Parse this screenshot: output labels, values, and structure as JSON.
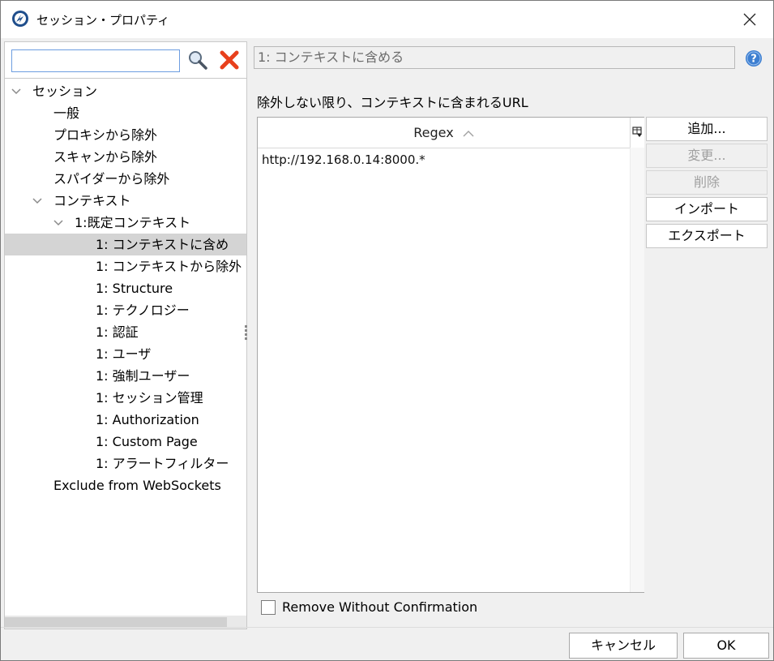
{
  "window": {
    "title": "セッション・プロパティ"
  },
  "search": {
    "placeholder": "",
    "value": ""
  },
  "tree": {
    "items": [
      {
        "label": "セッション",
        "expanded": true
      },
      {
        "label": "一般"
      },
      {
        "label": "プロキシから除外"
      },
      {
        "label": "スキャンから除外"
      },
      {
        "label": "スパイダーから除外"
      },
      {
        "label": "コンテキスト",
        "expanded": true
      },
      {
        "label": "1:既定コンテキスト",
        "expanded": true
      },
      {
        "label": "1: コンテキストに含め",
        "selected": true
      },
      {
        "label": "1: コンテキストから除外"
      },
      {
        "label": "1: Structure"
      },
      {
        "label": "1: テクノロジー"
      },
      {
        "label": "1: 認証"
      },
      {
        "label": "1: ユーザ"
      },
      {
        "label": "1: 強制ユーザー"
      },
      {
        "label": "1: セッション管理"
      },
      {
        "label": "1: Authorization"
      },
      {
        "label": "1: Custom Page"
      },
      {
        "label": "1: アラートフィルター"
      },
      {
        "label": "Exclude from WebSockets"
      }
    ]
  },
  "panel": {
    "title": "1: コンテキストに含める",
    "section_label": "除外しない限り、コンテキストに含まれるURL",
    "table": {
      "header": "Regex",
      "rows": [
        "http://192.168.0.14:8000.*"
      ]
    },
    "buttons": {
      "add": "追加...",
      "modify": "変更...",
      "remove": "削除",
      "import": "インポート",
      "export": "エクスポート"
    },
    "remove_without_confirmation": "Remove Without Confirmation"
  },
  "footer": {
    "cancel": "キャンセル",
    "ok": "OK"
  },
  "colors": {
    "clear_icon": "#e8401c",
    "help_icon": "#3d7fd1",
    "selection": "#d4d4d4"
  }
}
